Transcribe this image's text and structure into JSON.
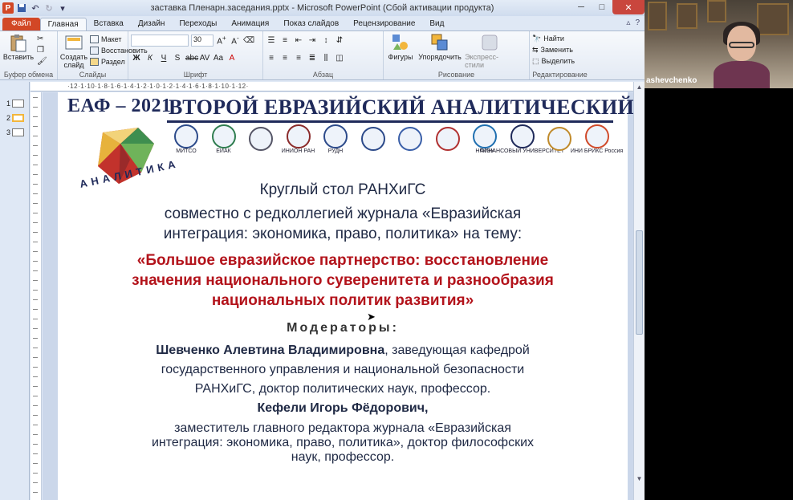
{
  "window": {
    "title": "заставка Пленарн.заседания.pptx  -  Microsoft PowerPoint (Сбой активации продукта)"
  },
  "tabs": [
    {
      "label": "Файл"
    },
    {
      "label": "Главная"
    },
    {
      "label": "Вставка"
    },
    {
      "label": "Дизайн"
    },
    {
      "label": "Переходы"
    },
    {
      "label": "Анимация"
    },
    {
      "label": "Показ слайдов"
    },
    {
      "label": "Рецензирование"
    },
    {
      "label": "Вид"
    }
  ],
  "ribbon": {
    "clipboard": {
      "paste": "Вставить",
      "label": "Буфер обмена"
    },
    "slides": {
      "new_slide_1": "Создать",
      "new_slide_2": "слайд",
      "layout": "Макет",
      "reset": "Восстановить",
      "section": "Раздел",
      "label": "Слайды"
    },
    "font": {
      "size": "30",
      "label": "Шрифт"
    },
    "paragraph": {
      "label": "Абзац"
    },
    "drawing": {
      "shapes": "Фигуры",
      "arrange": "Упорядочить",
      "quick_styles": "Экспресс-стили",
      "label": "Рисование"
    },
    "editing": {
      "find": "Найти",
      "replace": "Заменить",
      "select": "Выделить",
      "label": "Редактирование"
    }
  },
  "ruler": {
    "text": "·12·1·10·1·8·1·6·1·4·1·2·1·0·1·2·1·4·1·6·1·8·1·10·1·12·"
  },
  "thumbnails": [
    {
      "num": "1",
      "active": false
    },
    {
      "num": "2",
      "active": true
    },
    {
      "num": "3",
      "active": false
    }
  ],
  "slide": {
    "eaf": "ЕАФ – 2021",
    "forum": "ВТОРОЙ ЕВРАЗИЙСКИЙ АНАЛИТИЧЕСКИЙ ФОРУМ",
    "analitika": "АНАЛИТИКА",
    "logos": [
      {
        "caption": "МИТСО"
      },
      {
        "caption": "ЕИАК"
      },
      {
        "caption": ""
      },
      {
        "caption": "ИНИОН РАН"
      },
      {
        "caption": "РУДН"
      },
      {
        "caption": ""
      },
      {
        "caption": ""
      },
      {
        "caption": ""
      },
      {
        "caption": "НГИЭУ"
      },
      {
        "caption": "ФИНАНСОВЫЙ УНИВЕРСИТЕТ"
      },
      {
        "caption": ""
      },
      {
        "caption": "ИНИ БРИКС Россия"
      }
    ],
    "line1": "Круглый стол РАНХиГС",
    "line2": "совместно с редколлегией журнала «Евразийская",
    "line3": "интеграция: экономика, право, политика» на тему:",
    "red1": "«Большое евразийское партнерство: восстановление",
    "red2": "значения национального суверенитета и разнообразия",
    "red3": "национальных политик развития»",
    "moderators": "Модераторы:",
    "mod1_name": "Шевченко Алевтина Владимировна",
    "mod1_rest": ", заведующая кафедрой",
    "p2": "государственного управления  и национальной безопасности",
    "p3": "РАНХиГС, доктор политических наук, профессор.",
    "mod2_name": "Кефели Игорь Фёдорович,",
    "p5": "заместитель главного редактора журнала «Евразийская",
    "p6": "интеграция: экономика, право, политика», доктор философских",
    "p7": "наук, профессор."
  },
  "webcam": {
    "participant": "ashevchenko"
  }
}
